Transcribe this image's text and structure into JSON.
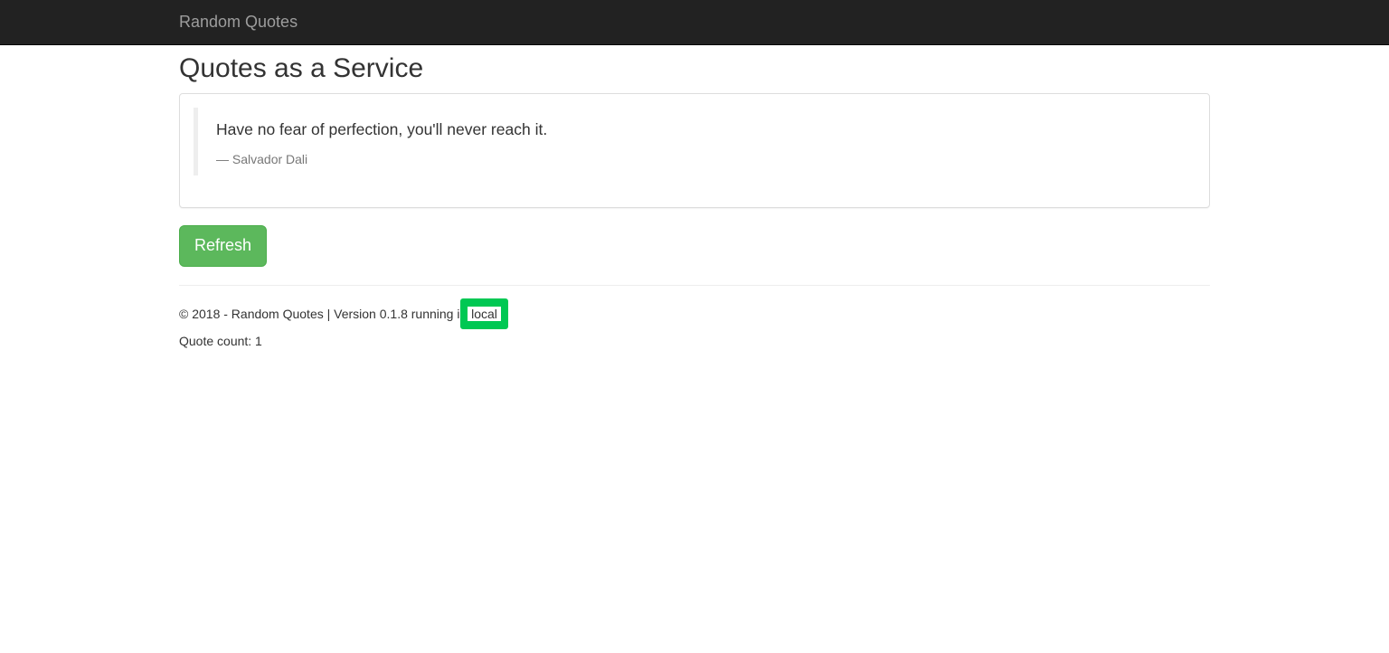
{
  "navbar": {
    "brand": "Random Quotes",
    "background_color": "#222222"
  },
  "page": {
    "title": "Quotes as a Service"
  },
  "quote": {
    "text": "Have no fear of perfection, you'll never reach it.",
    "author": "— Salvador Dali"
  },
  "actions": {
    "refresh_label": "Refresh",
    "refresh_color": "#5cb85c"
  },
  "footer": {
    "info_text": "© 2018 - Random Quotes | Version 0.1.8 running i",
    "environment": "local",
    "highlight_color": "#00c853",
    "quote_count_label": "Quote count: 1"
  }
}
